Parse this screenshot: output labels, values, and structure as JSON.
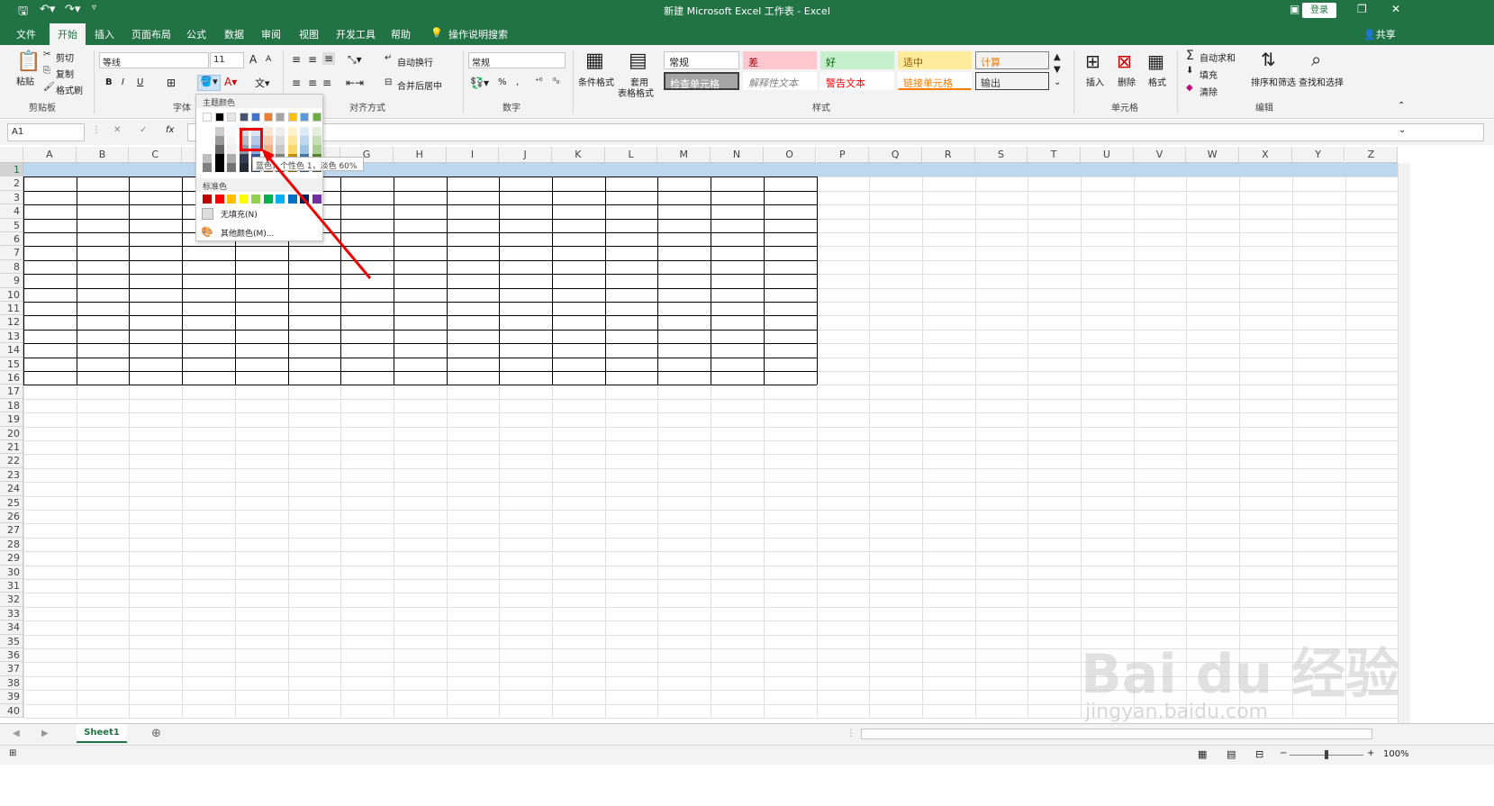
{
  "title": "新建 Microsoft Excel 工作表 - Excel",
  "login_label": "登录",
  "share_label": "共享",
  "tabs": [
    "文件",
    "开始",
    "插入",
    "页面布局",
    "公式",
    "数据",
    "审阅",
    "视图",
    "开发工具",
    "帮助",
    "操作说明搜索"
  ],
  "ribbon": {
    "clipboard": {
      "paste": "粘贴",
      "cut": "剪切",
      "copy": "复制",
      "format_painter": "格式刷",
      "group": "剪贴板"
    },
    "font": {
      "name": "等线",
      "size": "11",
      "bold": "B",
      "italic": "I",
      "underline": "U",
      "group": "字体",
      "grow": "A",
      "shrink": "A"
    },
    "alignment": {
      "wrap": "自动换行",
      "merge": "合并后居中",
      "group": "对齐方式"
    },
    "number": {
      "format": "常规",
      "percent": "%",
      "comma": ",",
      "group": "数字"
    },
    "styles": {
      "conditional": "条件格式",
      "table_format_1": "套用",
      "table_format_2": "表格格式",
      "group": "样式",
      "cells": [
        "常规",
        "差",
        "好",
        "适中",
        "计算",
        "检查单元格",
        "解释性文本",
        "警告文本",
        "链接单元格",
        "输出"
      ]
    },
    "cells": {
      "insert": "插入",
      "delete": "删除",
      "format": "格式",
      "group": "单元格"
    },
    "editing": {
      "autosum": "自动求和",
      "fill": "填充",
      "clear": "清除",
      "sort": "排序和筛选",
      "find": "查找和选择",
      "group": "编辑"
    }
  },
  "name_box": "A1",
  "columns": [
    "A",
    "B",
    "C",
    "D",
    "E",
    "F",
    "G",
    "H",
    "I",
    "J",
    "K",
    "L",
    "M",
    "N",
    "O",
    "P",
    "Q",
    "R",
    "S",
    "T",
    "U",
    "V",
    "W",
    "X",
    "Y",
    "Z"
  ],
  "rows": [
    "1",
    "2",
    "3",
    "4",
    "5",
    "6",
    "7",
    "8",
    "9",
    "10",
    "11",
    "12",
    "13",
    "14",
    "15",
    "16",
    "17",
    "18",
    "19",
    "20",
    "21",
    "22",
    "23",
    "24",
    "25",
    "26",
    "27",
    "28",
    "29",
    "30",
    "31",
    "32",
    "33",
    "34",
    "35",
    "36",
    "37",
    "38",
    "39",
    "40"
  ],
  "color_popup": {
    "theme_label": "主题颜色",
    "standard_label": "标准色",
    "no_fill": "无填充(N)",
    "more_colors": "其他颜色(M)...",
    "tooltip": "蓝色，个性色 1，淡色 60%",
    "theme_colors": [
      "#ffffff",
      "#000000",
      "#e7e6e6",
      "#44546a",
      "#4472c4",
      "#ed7d31",
      "#a5a5a5",
      "#ffc000",
      "#5b9bd5",
      "#70ad47"
    ],
    "standard_colors": [
      "#c00000",
      "#ff0000",
      "#ffc000",
      "#ffff00",
      "#92d050",
      "#00b050",
      "#00b0f0",
      "#0070c0",
      "#002060",
      "#7030a0"
    ]
  },
  "sheet_tab": "Sheet1",
  "zoom": "100%",
  "watermark": "Bai du 经验",
  "watermark_url": "jingyan.baidu.com"
}
